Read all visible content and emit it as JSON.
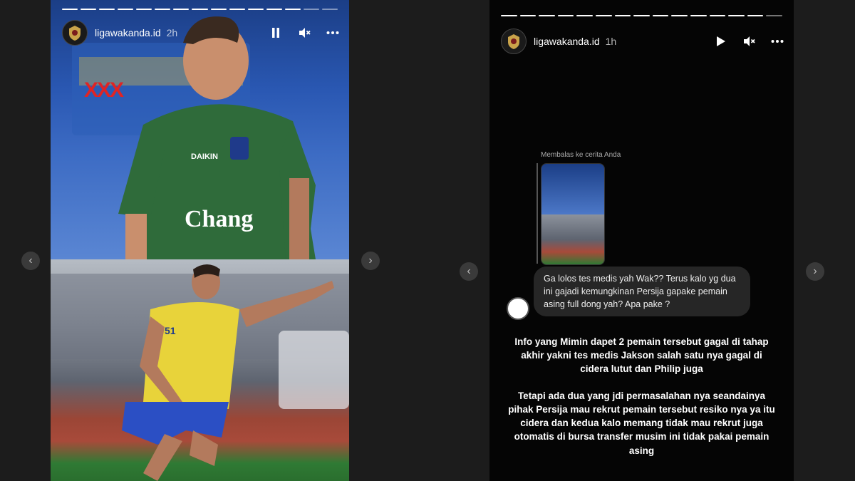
{
  "left_story": {
    "username": "ligawakanda.id",
    "time": "2h",
    "overlay_mark": "XXX",
    "photo_top": {
      "jersey_sponsor_1": "DAIKIN",
      "jersey_sponsor_2": "Chang"
    },
    "photo_bottom": {
      "player_number": "51"
    }
  },
  "right_story": {
    "username": "ligawakanda.id",
    "time": "1h",
    "reply_label": "Membalas ke cerita Anda",
    "message": "Ga lolos tes medis yah Wak?? Terus kalo yg dua ini gajadi kemungkinan Persija gapake pemain asing full dong yah? Apa pake ?",
    "caption_1": "Info yang Mimin dapet 2 pemain tersebut gagal di tahap akhir yakni tes medis Jakson salah satu nya gagal di cidera lutut dan Philip juga",
    "caption_2": "Tetapi ada dua yang jdi permasalahan nya seandainya pihak Persija mau rekrut pemain tersebut resiko nya ya itu cidera dan kedua kalo memang tidak mau rekrut juga otomatis di bursa transfer musim ini tidak pakai pemain asing"
  },
  "icons": {
    "pause": "pause-icon",
    "play": "play-icon",
    "mute": "muted-speaker-icon",
    "more": "more-dots-icon",
    "prev": "chevron-left-icon",
    "next": "chevron-right-icon"
  },
  "colors": {
    "background": "#1c1c1c",
    "overlay_mark": "#e02424",
    "bubble": "#262626"
  }
}
